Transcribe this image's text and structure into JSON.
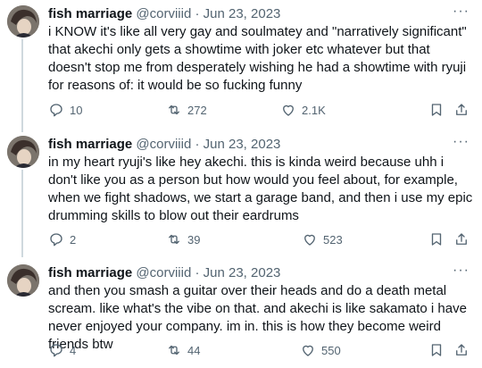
{
  "tweets": [
    {
      "name": "fish marriage",
      "handle": "@corviiid",
      "dot": "·",
      "date": "Jun 23, 2023",
      "more": "···",
      "text": "i KNOW it's like all very gay and soulmatey and \"narratively significant\" that akechi only gets a showtime with joker etc whatever but that doesn't stop me from desperately wishing he had a showtime with ryuji for reasons of: it would be so fucking funny",
      "replies": "10",
      "retweets": "272",
      "likes": "2.1K"
    },
    {
      "name": "fish marriage",
      "handle": "@corviiid",
      "dot": "·",
      "date": "Jun 23, 2023",
      "more": "···",
      "text": "in my heart ryuji's like hey akechi. this is kinda weird because uhh i don't like you as a person but how would you feel about, for example, when we fight shadows, we start a garage band, and then i use my epic drumming skills to blow out their eardrums",
      "replies": "2",
      "retweets": "39",
      "likes": "523"
    },
    {
      "name": "fish marriage",
      "handle": "@corviiid",
      "dot": "·",
      "date": "Jun 23, 2023",
      "more": "···",
      "text": "and then you smash a guitar over their heads and do a death metal scream. like what's the vibe on that. and akechi is like sakamato i have never enjoyed your company. im in. this is how they become weird friends btw",
      "replies": "4",
      "retweets": "44",
      "likes": "550"
    }
  ]
}
